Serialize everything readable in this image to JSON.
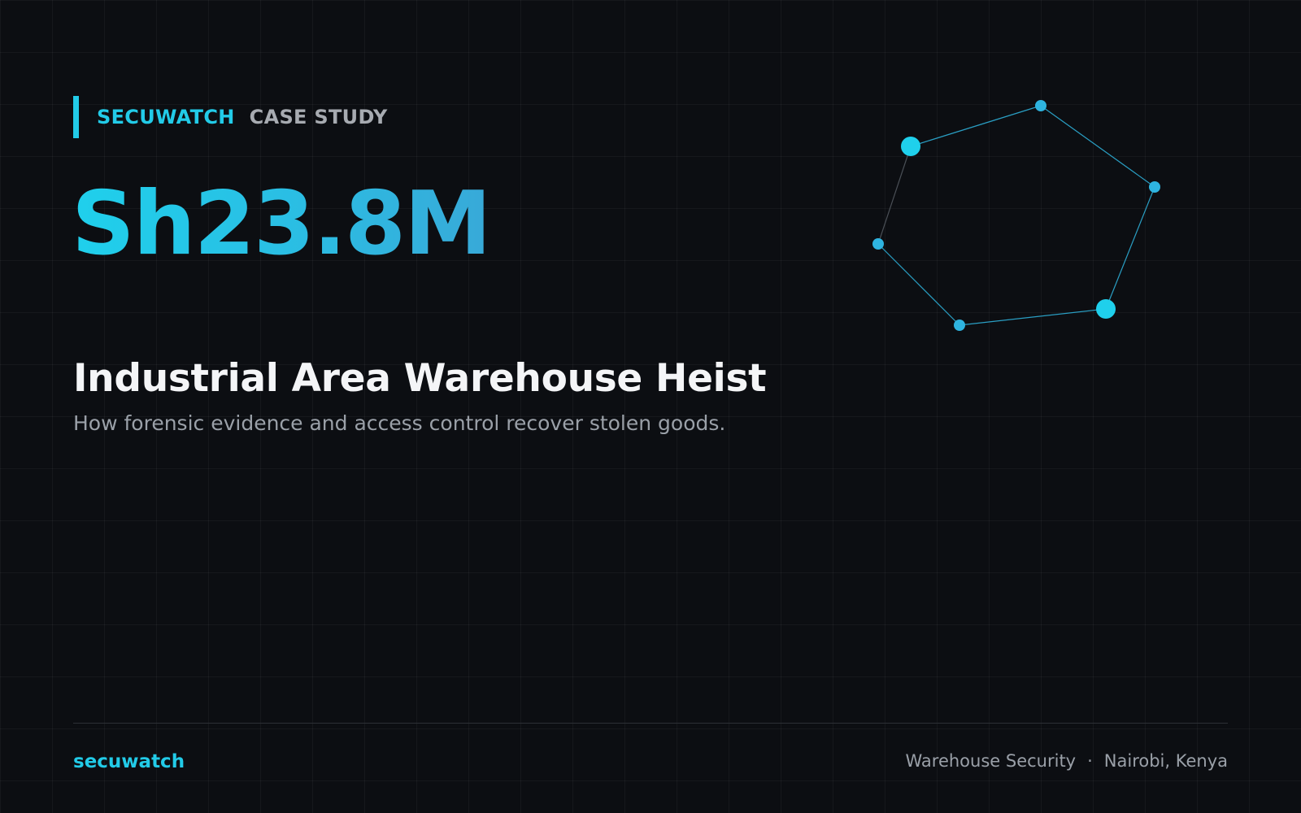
{
  "header": {
    "brand": "SECUWATCH",
    "tag": "CASE STUDY"
  },
  "hero": {
    "stat": "Sh23.8M",
    "title": "Industrial Area Warehouse Heist",
    "subtitle": "How forensic evidence and access control recover stolen goods."
  },
  "footer": {
    "brand": "secuwatch",
    "category": "Warehouse Security",
    "separator": "·",
    "location": "Nairobi, Kenya"
  },
  "colors": {
    "background": "#0c0e12",
    "accent": "#22cbe8",
    "title": "#f4f5f7",
    "muted": "#9aa0a8"
  },
  "decoration": {
    "icon": "network-graph-icon"
  }
}
